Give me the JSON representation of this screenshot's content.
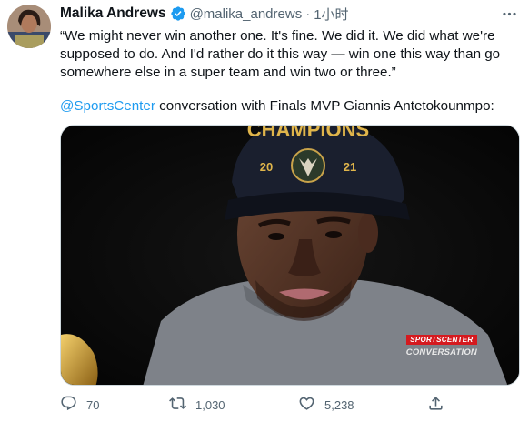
{
  "author": {
    "name": "Malika Andrews",
    "handle": "@malika_andrews",
    "separator": "·",
    "time": "1小时"
  },
  "tweet": {
    "quote": "“We might never win another one. It's fine. We did it. We did what we're supposed to do. And I'd rather do it this way — win one this way than go somewhere else in a super team and win two or three.”",
    "mention": "@SportsCenter",
    "caption_rest": " conversation with Finals MVP Giannis Antetokounmpo:"
  },
  "media": {
    "cap_text": "CHAMPIONS",
    "cap_year_left": "20",
    "cap_year_right": "21",
    "watermark_logo": "SPORTSCENTER",
    "watermark_text": "CONVERSATION"
  },
  "actions": {
    "replies": "70",
    "retweets": "1,030",
    "likes": "5,238"
  },
  "icons": {
    "verified": "verified-badge-icon",
    "more": "more-dots-icon",
    "reply": "reply-icon",
    "retweet": "retweet-icon",
    "like": "heart-icon",
    "share": "share-icon"
  },
  "colors": {
    "accent": "#1d9bf0",
    "secondary_text": "#536471",
    "primary_text": "#0f1419"
  }
}
